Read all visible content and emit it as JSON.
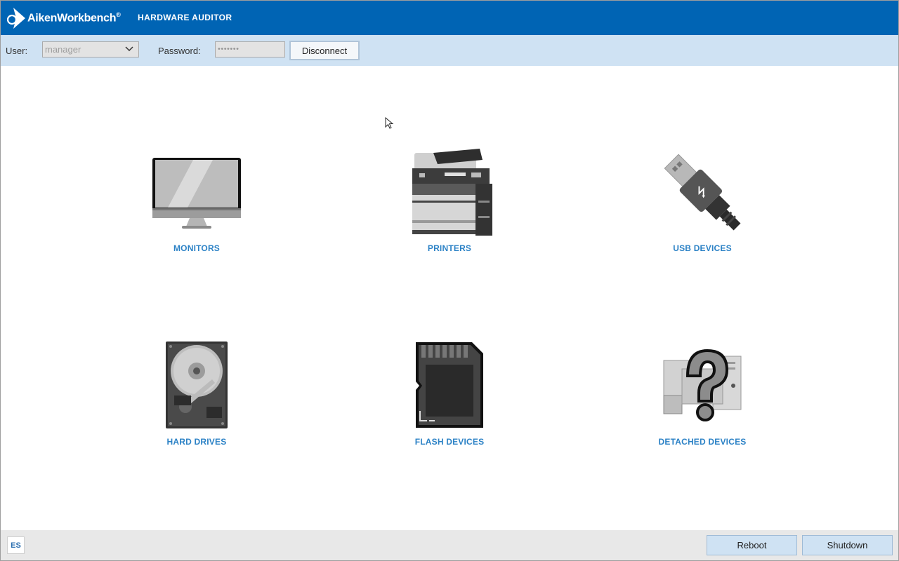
{
  "header": {
    "logo_text": "AikenWorkbench",
    "logo_mark": "®",
    "app_title": "HARDWARE AUDITOR"
  },
  "login": {
    "user_label": "User:",
    "user_value": "manager",
    "password_label": "Password:",
    "password_value": "•••••••",
    "disconnect_label": "Disconnect"
  },
  "tiles": [
    {
      "label": "MONITORS",
      "icon": "monitor-icon"
    },
    {
      "label": "PRINTERS",
      "icon": "printer-icon"
    },
    {
      "label": "USB DEVICES",
      "icon": "usb-icon"
    },
    {
      "label": "HARD DRIVES",
      "icon": "hard-drive-icon"
    },
    {
      "label": "FLASH DEVICES",
      "icon": "sd-card-icon"
    },
    {
      "label": "DETACHED DEVICES",
      "icon": "question-mark-icon"
    }
  ],
  "footer": {
    "language": "ES",
    "reboot_label": "Reboot",
    "shutdown_label": "Shutdown"
  },
  "colors": {
    "header_bg": "#0064b4",
    "loginbar_bg": "#cfe2f3",
    "tile_label": "#2c82c6",
    "footer_bg": "#e8e8e8"
  }
}
